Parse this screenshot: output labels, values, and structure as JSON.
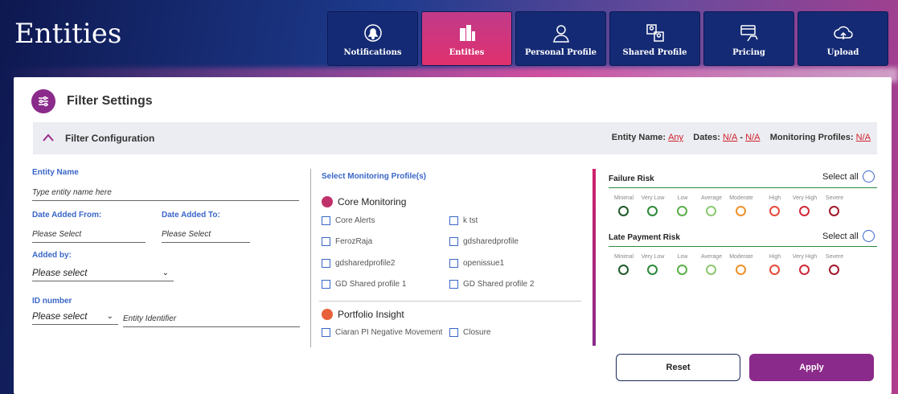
{
  "app": {
    "title": "Entities"
  },
  "tabs": [
    {
      "label": "Notifications",
      "icon": "bell-icon",
      "active": false
    },
    {
      "label": "Entities",
      "icon": "buildings-icon",
      "active": true
    },
    {
      "label": "Personal Profile",
      "icon": "person-icon",
      "active": false
    },
    {
      "label": "Shared Profile",
      "icon": "shared-profile-icon",
      "active": false
    },
    {
      "label": "Pricing",
      "icon": "card-hand-icon",
      "active": false
    },
    {
      "label": "Upload",
      "icon": "cloud-upload-icon",
      "active": false
    }
  ],
  "filter": {
    "title": "Filter Settings",
    "config_title": "Filter Configuration",
    "summary": {
      "entity_name_label": "Entity Name:",
      "entity_name_value": "Any",
      "dates_label": "Dates:",
      "dates_from": "N/A",
      "dates_sep": "-",
      "dates_to": "N/A",
      "monitoring_label": "Monitoring Profiles:",
      "monitoring_value": "N/A"
    }
  },
  "form": {
    "entity_name_label": "Entity Name",
    "entity_name_placeholder": "Type entity name here",
    "date_from_label": "Date Added From:",
    "date_from_value": "Please Select",
    "date_to_label": "Date Added To:",
    "date_to_value": "Please Select",
    "added_by_label": "Added by:",
    "added_by_value": "Please select",
    "id_label": "ID number",
    "id_type_value": "Please select",
    "id_placeholder": "Entity Identifier"
  },
  "monitoring": {
    "title": "Select Monitoring Profile(s)",
    "groups": [
      {
        "name": "Core Monitoring",
        "items": [
          "Core Alerts",
          "k tst",
          "FerozRaja",
          "gdsharedprofile",
          "gdsharedprofile2",
          "openissue1",
          "GD Shared profile 1",
          "GD Shared profile 2"
        ]
      },
      {
        "name": "Portfolio Insight",
        "items": [
          "Ciaran PI Negative Movement",
          "Closure"
        ]
      }
    ]
  },
  "risk": {
    "levels": [
      "Minimal",
      "Very Low",
      "Low",
      "Average",
      "Moderate",
      "High",
      "Very High",
      "Severe"
    ],
    "colors": [
      "#1f5a2a",
      "#2e8a3a",
      "#5ab04a",
      "#8cc870",
      "#f0902a",
      "#e84a3a",
      "#d02a3a",
      "#a01a2a"
    ],
    "failure": {
      "title": "Failure Risk",
      "select_all": "Select all"
    },
    "late": {
      "title": "Late Payment Risk",
      "select_all": "Select all"
    }
  },
  "actions": {
    "reset": "Reset",
    "apply": "Apply"
  }
}
